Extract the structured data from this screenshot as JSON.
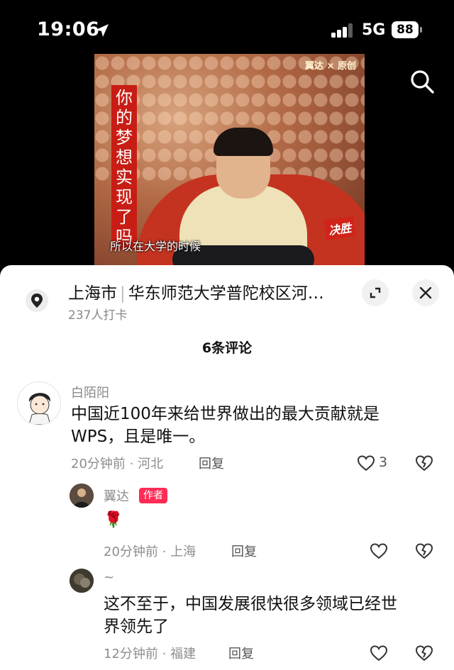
{
  "status_bar": {
    "time": "19:06",
    "network": "5G",
    "battery": "88"
  },
  "video": {
    "banner_text": "你的梦想实现了吗",
    "watermark": "翼达 × 原创",
    "caption": "所以在大学的时候",
    "show_logo": "决胜"
  },
  "location": {
    "city": "上海市",
    "place": "华东师范大学普陀校区河…",
    "checkins": "237人打卡"
  },
  "comments_header": "6条评论",
  "comments": [
    {
      "name": "白陌阳",
      "text_line1": "中国近100年来给世界做出的最大贡献就是",
      "text_line2": "WPS，且是唯一。",
      "meta": "20分钟前 · 河北",
      "reply": "回复",
      "likes": "3"
    },
    {
      "name": "翼达",
      "tag": "作者",
      "text": "🌹",
      "meta": "20分钟前 · 上海",
      "reply": "回复"
    },
    {
      "name": "~",
      "text_line1": "这不至于，中国发展很快很多领域已经世",
      "text_line2": "界领先了",
      "meta": "12分钟前 · 福建",
      "reply": "回复"
    }
  ],
  "colors": {
    "author_tag": "#fe2c55",
    "banner": "#c81d14"
  }
}
